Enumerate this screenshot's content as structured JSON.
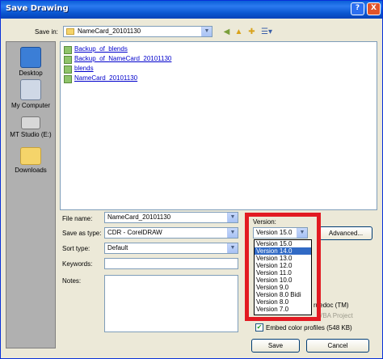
{
  "window": {
    "title": "Save Drawing",
    "help": "?",
    "close": "X"
  },
  "save_in": {
    "label": "Save in:",
    "value": "NameCard_20101130"
  },
  "places": [
    {
      "label": "Desktop"
    },
    {
      "label": "My Computer"
    },
    {
      "label": "MT Studio (E:)"
    },
    {
      "label": "Downloads"
    }
  ],
  "files": [
    {
      "name": "Backup_of_blends"
    },
    {
      "name": "Backup_of_NameCard_20101130"
    },
    {
      "name": "blends"
    },
    {
      "name": "NameCard_20101130"
    }
  ],
  "form": {
    "file_name": {
      "label": "File name:",
      "value": "NameCard_20101130"
    },
    "save_as_type": {
      "label": "Save as type:",
      "value": "CDR - CorelDRAW"
    },
    "sort_type": {
      "label": "Sort type:",
      "value": "Default"
    },
    "keywords": {
      "label": "Keywords:",
      "value": ""
    },
    "notes": {
      "label": "Notes:",
      "value": ""
    }
  },
  "version": {
    "label": "Version:",
    "value": "Version 15.0",
    "options": [
      "Version 15.0",
      "Version 14.0",
      "Version 13.0",
      "Version 12.0",
      "Version 11.0",
      "Version 10.0",
      "Version 9.0",
      "Version 8.0 Bidi",
      "Version 8.0",
      "Version 7.0"
    ],
    "selected_index": 1
  },
  "advanced": "Advanced...",
  "partial": {
    "truedoc": "ruedoc (TM)",
    "vba": "VBA Project"
  },
  "embed_color": {
    "label": "Embed color profiles (548 KB)",
    "checked": true
  },
  "buttons": {
    "save": "Save",
    "cancel": "Cancel"
  },
  "colors": {
    "highlight_frame": "#e21a22",
    "selection": "#316ac5"
  }
}
